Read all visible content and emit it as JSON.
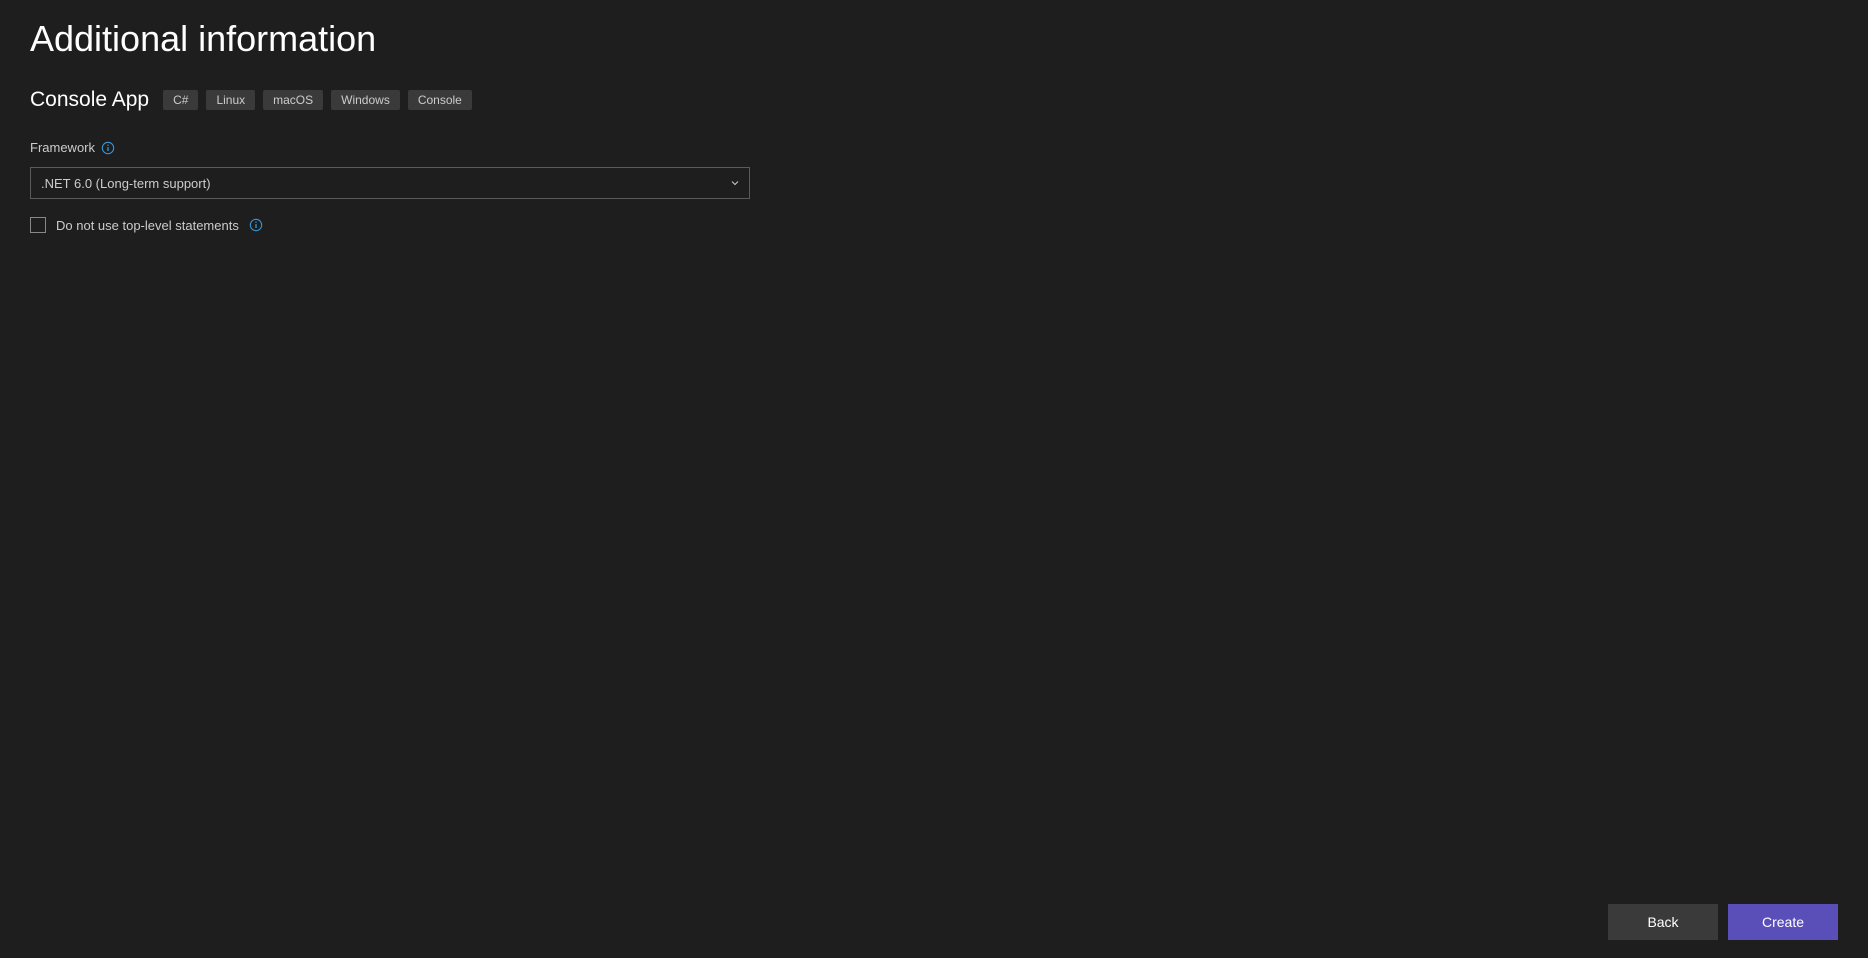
{
  "page": {
    "title": "Additional information"
  },
  "project": {
    "name": "Console App",
    "tags": [
      "C#",
      "Linux",
      "macOS",
      "Windows",
      "Console"
    ]
  },
  "form": {
    "framework_label": "Framework",
    "framework_value": ".NET 6.0 (Long-term support)",
    "top_level_checkbox_label": "Do not use top-level statements",
    "top_level_checked": false
  },
  "buttons": {
    "back": "Back",
    "create": "Create"
  }
}
